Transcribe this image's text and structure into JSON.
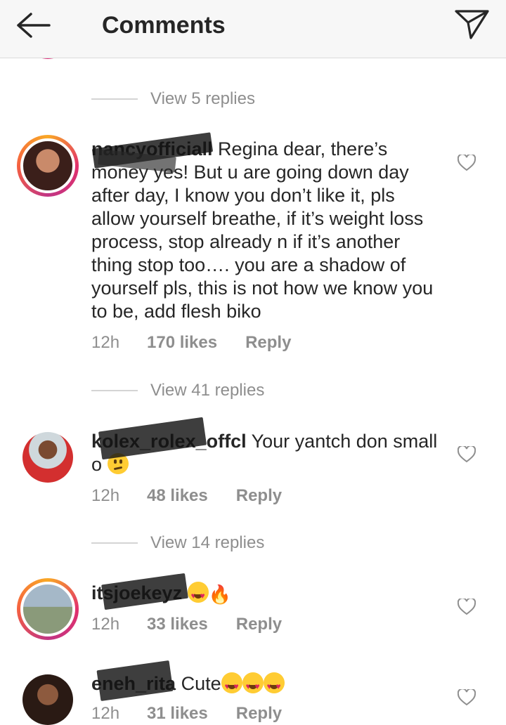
{
  "header": {
    "title": "Comments"
  },
  "view_replies": [
    "View 5 replies",
    "View 41 replies",
    "View 14 replies"
  ],
  "comments": [
    {
      "user": "nancyofficiall",
      "text": " Regina dear, there’s money yes! But u are going down day after day, I know you don’t like it, pls allow yourself breathe, if it’s weight loss process, stop already n if it’s another thing stop too…. you are a shadow of yourself pls, this is not how we know you to be, add flesh biko",
      "time": "12h",
      "likes": "170 likes",
      "reply": "Reply"
    },
    {
      "user": "kolex_rolex_offcl",
      "text": " Your yantch don small o ",
      "time": "12h",
      "likes": "48 likes",
      "reply": "Reply"
    },
    {
      "user": "itsjoekeyz",
      "text": " ",
      "time": "12h",
      "likes": "33 likes",
      "reply": "Reply"
    },
    {
      "user": "eneh_rita",
      "text": " Cute",
      "time": "12h",
      "likes": "31 likes",
      "reply": "Reply"
    }
  ],
  "icons": {
    "back": "arrow-left-icon",
    "share": "paper-plane-icon",
    "like": "heart-outline-icon"
  },
  "colors": {
    "muted": "#8e8e8e",
    "text": "#262626",
    "story_ring": "#e1306c"
  }
}
